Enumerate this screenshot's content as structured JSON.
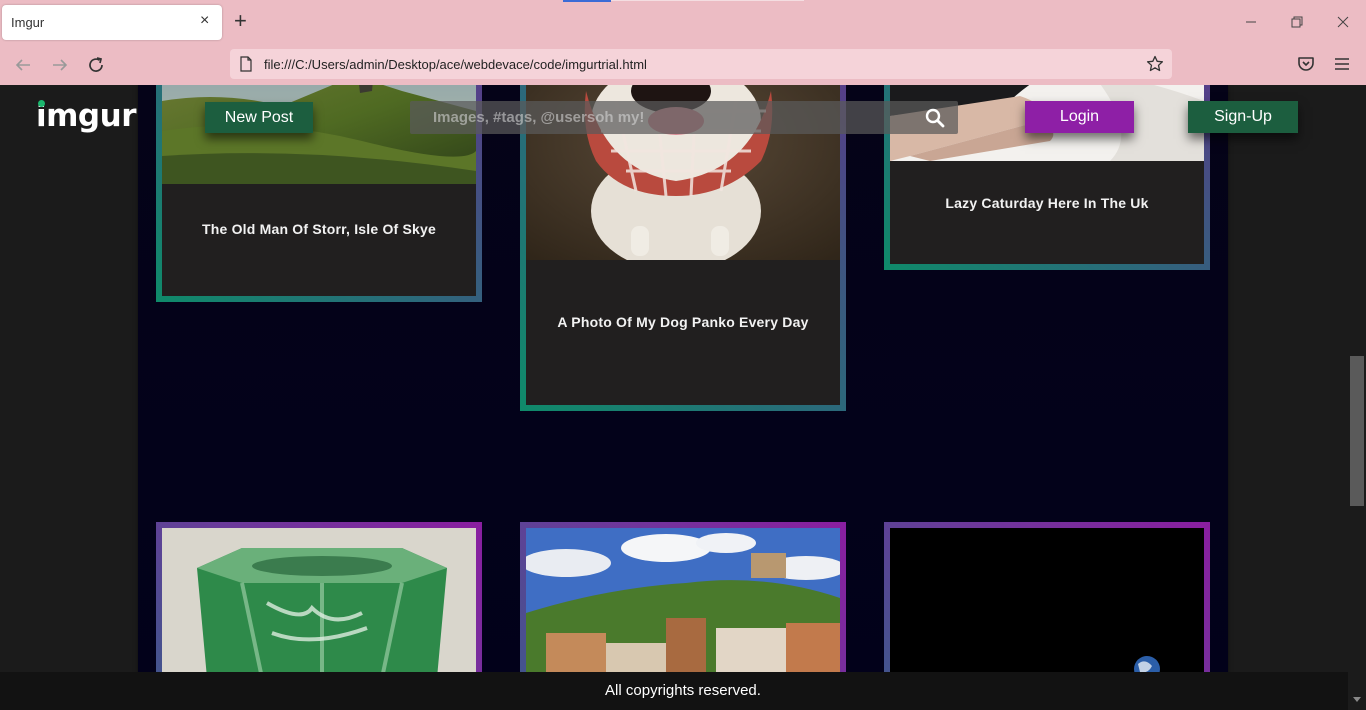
{
  "browser": {
    "tab_title": "Imgur",
    "tab_close": "×",
    "new_tab": "+",
    "url": "file:///C:/Users/admin/Desktop/ace/webdevace/code/imgurtrial.html"
  },
  "header": {
    "logo": "imgur",
    "new_post_label": "New Post",
    "search_placeholder": "Images, #tags, @usersoh my!",
    "login_label": "Login",
    "signup_label": "Sign-Up"
  },
  "cards": [
    {
      "caption": "The Old Man Of Storr, Isle Of Skye"
    },
    {
      "caption": "A Photo Of My Dog Panko Every Day"
    },
    {
      "caption": "Lazy Caturday Here In The Uk"
    }
  ],
  "footer": {
    "text": "All copyrights reserved."
  },
  "colors": {
    "login": "#8e1fa6",
    "signup": "#1c5e3f",
    "new_post": "#1c5e3f",
    "browser_chrome": "#ecbcc4"
  }
}
